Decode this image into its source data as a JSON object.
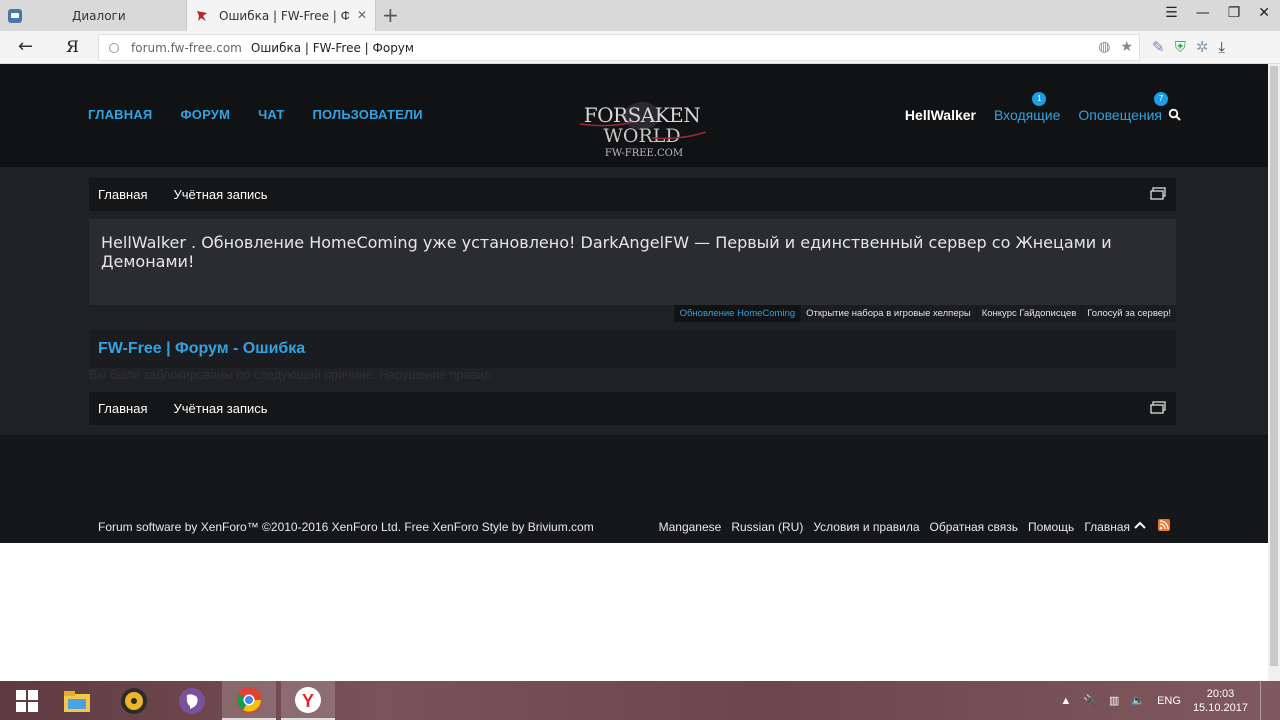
{
  "browser": {
    "tabs": [
      {
        "title": "Диалоги",
        "active": false
      },
      {
        "title": "Ошибка | FW-Free | Форум",
        "active": true
      }
    ],
    "new_tab": "+",
    "address": {
      "domain": "forum.fw-free.com",
      "title": "Ошибка | FW-Free | Форум"
    },
    "ya_logo": "Я"
  },
  "header": {
    "nav": [
      "ГЛАВНАЯ",
      "ФОРУМ",
      "ЧАТ",
      "ПОЛЬЗОВАТЕЛИ"
    ],
    "logo_text": [
      "FORSAKEN",
      "WORLD",
      "FW-FREE.COM"
    ],
    "username": "HellWalker",
    "inbox": {
      "label": "Входящие",
      "count": "1"
    },
    "alerts": {
      "label": "Оповещения",
      "count": "7"
    }
  },
  "breadcrumb": [
    "Главная",
    "Учётная запись"
  ],
  "notice": {
    "text": "HellWalker . Обновление HomeComing уже установлено! DarkAngelFW — Первый и единственный сервер со Жнецами и Демонами!",
    "tabs": [
      "Обновление HomeComing",
      "Открытие набора в игровые хелперы",
      "Конкурс Гайдописцев",
      "Голосуй за сервер!"
    ]
  },
  "page_title": "FW-Free | Форум - Ошибка",
  "error_message": "Вы были заблокированы по следующей причине: Нарушение правил",
  "footer": {
    "copyright": "Forum software by XenForo™ ©2010-2016 XenForo Ltd. Free XenForo Style by Brivium.com",
    "links": [
      "Manganese",
      "Russian (RU)",
      "Условия и правила",
      "Обратная связь",
      "Помощь",
      "Главная"
    ]
  },
  "taskbar": {
    "lang": "ENG",
    "time": "20:03",
    "date": "15.10.2017"
  },
  "colors": {
    "accent": "#33a2e2",
    "header_bg": "#111214",
    "page_bg": "#202124"
  }
}
